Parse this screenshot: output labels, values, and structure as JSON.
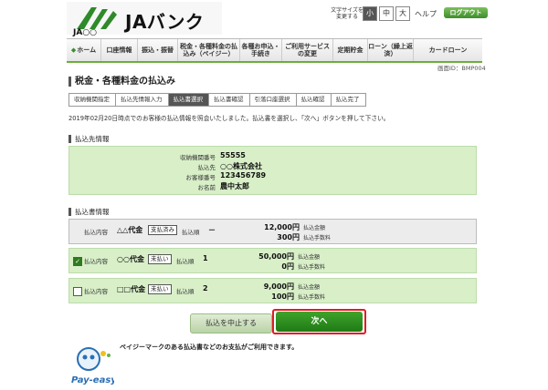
{
  "header": {
    "brand": "JAバンク",
    "sub_brand": "JA○○",
    "font_size_label_1": "文字サイズを",
    "font_size_label_2": "変更する",
    "font_sizes": [
      "小",
      "中",
      "大"
    ],
    "help": "ヘルプ",
    "logout": "ログアウト"
  },
  "nav": [
    "ホーム",
    "口座情報",
    "振込・振替",
    "税金・各種料金の払込み（ペイジー）",
    "各種お申込・手続き",
    "ご利用サービスの変更",
    "定期貯金",
    "ローン（繰上返済）",
    "カードローン"
  ],
  "screen_id": "画面ID：BMP004",
  "title": "税金・各種料金の払込み",
  "steps": [
    "収納機関指定",
    "払込先情報入力",
    "払込書選択",
    "払込書確認",
    "引落口座選択",
    "払込確認",
    "払込完了"
  ],
  "active_step": 2,
  "instruction": "2019年02月20日時点でのお客様の払込情報を照会いたしました。払込書を選択し、「次へ」ボタンを押して下さい。",
  "payee": {
    "section_title": "払込先情報",
    "rows": [
      {
        "label": "収納機関番号",
        "value": "55555"
      },
      {
        "label": "払込先",
        "value": "○○株式会社"
      },
      {
        "label": "お客様番号",
        "value": "123456789"
      },
      {
        "label": "お名前",
        "value": "農中太郎"
      }
    ]
  },
  "bills": {
    "section_title": "払込書情報",
    "content_label": "払込内容",
    "order_label": "払込順",
    "amount_label": "払込金額",
    "fee_label": "払込手数料",
    "rows": [
      {
        "checked": false,
        "checkbox": false,
        "name": "△△代金",
        "status": "支払済み",
        "order": "－",
        "amount": "12,000円",
        "fee": "300円"
      },
      {
        "checked": true,
        "checkbox": true,
        "name": "○○代金",
        "status": "未払い",
        "order": "1",
        "amount": "50,000円",
        "fee": "0円"
      },
      {
        "checked": false,
        "checkbox": true,
        "name": "□□代金",
        "status": "未払い",
        "order": "2",
        "amount": "9,000円",
        "fee": "100円"
      }
    ]
  },
  "buttons": {
    "cancel": "払込を中止する",
    "next": "次へ"
  },
  "payeasy": {
    "logo_text": "Pay-easy",
    "note": "ペイジーマークのある払込書などのお支払がご利用できます。"
  },
  "colors": {
    "accent_green": "#3fa32c",
    "panel_green": "#d8efc8",
    "highlight_red": "#e21b24"
  }
}
